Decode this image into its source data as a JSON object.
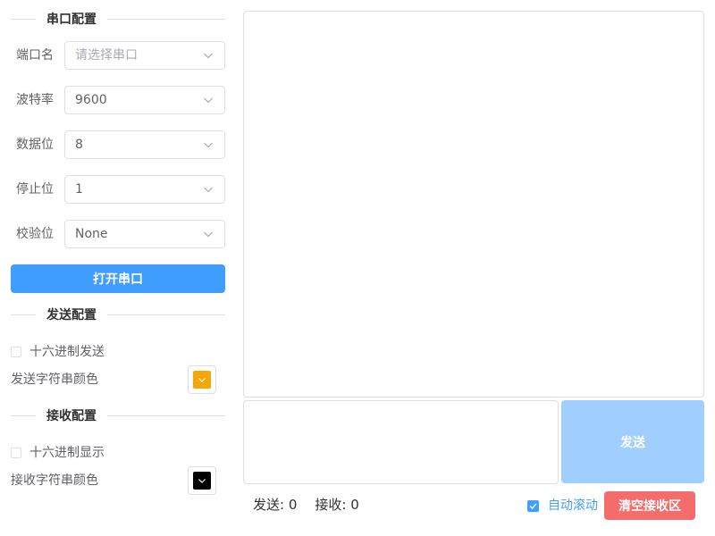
{
  "serial_config": {
    "title": "串口配置",
    "port": {
      "label": "端口名",
      "placeholder": "请选择串口",
      "value": ""
    },
    "baud_rate": {
      "label": "波特率",
      "value": "9600"
    },
    "data_bits": {
      "label": "数据位",
      "value": "8"
    },
    "stop_bits": {
      "label": "停止位",
      "value": "1"
    },
    "parity": {
      "label": "校验位",
      "value": "None"
    },
    "open_button_label": "打开串口"
  },
  "send_config": {
    "title": "发送配置",
    "hex_send_label": "十六进制发送",
    "hex_send_checked": false,
    "color_label": "发送字符串颜色",
    "color": "#f5a70a"
  },
  "receive_config": {
    "title": "接收配置",
    "hex_display_label": "十六进制显示",
    "hex_display_checked": false,
    "color_label": "接收字符串颜色",
    "color": "#000000"
  },
  "main": {
    "send_button_label": "发送",
    "send_count_text": "发送: 0",
    "receive_count_text": "接收: 0",
    "auto_scroll_label": "自动滚动",
    "auto_scroll_checked": true,
    "clear_button_label": "清空接收区"
  },
  "colors": {
    "primary": "#409eff",
    "primary_light": "#a0cfff",
    "danger": "#f56c6c",
    "border": "#dcdfe6"
  },
  "icons": {
    "select_arrow": "chevron-down-icon",
    "checkbox_check": "check-icon"
  }
}
